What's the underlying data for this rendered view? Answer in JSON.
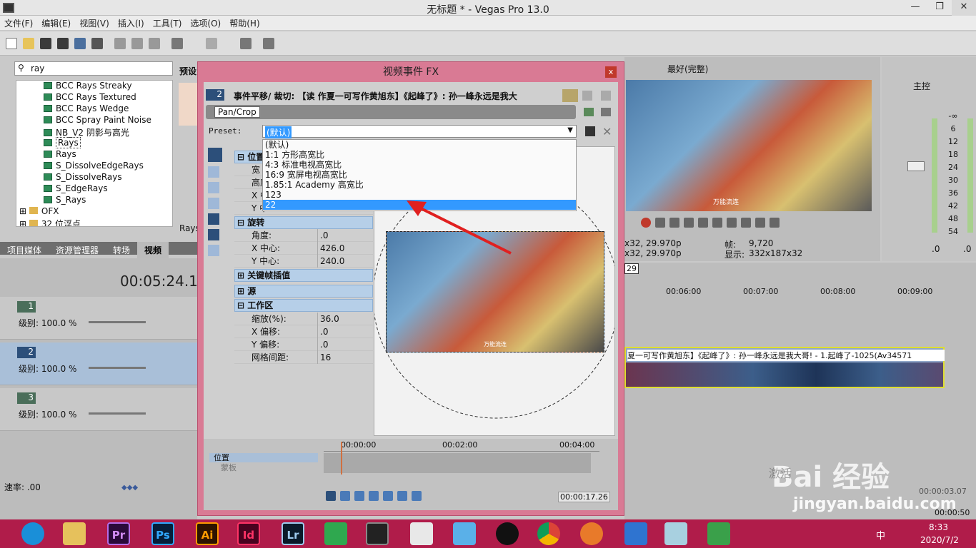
{
  "window": {
    "title": "无标题 * - Vegas Pro 13.0",
    "minimize": "—",
    "restore": "❐",
    "close": "✕"
  },
  "menu": [
    "文件(F)",
    "编辑(E)",
    "视图(V)",
    "插入(I)",
    "工具(T)",
    "选项(O)",
    "帮助(H)"
  ],
  "explorer": {
    "search_value": "ray",
    "preset_label": "预设",
    "items": [
      "BCC Rays Streaky",
      "BCC Rays Textured",
      "BCC Rays Wedge",
      "BCC Spray Paint Noise",
      "NB_V2 阴影与高光",
      "Rays",
      "Rays",
      "S_DissolveEdgeRays",
      "S_DissolveRays",
      "S_EdgeRays",
      "S_Rays"
    ],
    "folders": [
      "OFX",
      "32 位浮点"
    ],
    "selected_index": 5,
    "preview_caption": "Rays",
    "tabs": [
      "项目媒体",
      "资源管理器",
      "转场",
      "视频"
    ]
  },
  "timecode": "00:05:24.10",
  "tracks": [
    {
      "num": "1",
      "level": "级别: 100.0 %"
    },
    {
      "num": "2",
      "level": "级别: 100.0 %"
    },
    {
      "num": "3",
      "level": "级别: 100.0 %"
    }
  ],
  "rate_label": "速率: .00",
  "fx": {
    "title": "视频事件 FX",
    "close": "x",
    "chain_badge": "2",
    "chain_title": "事件平移/ 裁切: 【读 作夏一可写作黄旭东】《起峰了》: 孙一峰永远是我大",
    "plugin": "Pan/Crop",
    "preset_label": "Preset:",
    "preset_value": "(默认)",
    "preset_options": [
      "(默认)",
      "1:1 方形高宽比",
      "4:3 标准电视高宽比",
      "16:9 宽屏电视高宽比",
      "1.85:1 Academy 高宽比",
      "123",
      "22"
    ],
    "preset_selected": 6,
    "sections": {
      "position": "位置",
      "position_rows": [
        "宽",
        "高度",
        "X 中",
        "Y 中"
      ],
      "rotation": "旋转",
      "rotation_rows": [
        [
          "角度:",
          ".0"
        ],
        [
          "X 中心:",
          "426.0"
        ],
        [
          "Y 中心:",
          "240.0"
        ]
      ],
      "keyframe": "关键帧插值",
      "source": "源",
      "workspace": "工作区",
      "workspace_rows": [
        [
          "缩放(%):",
          "36.0"
        ],
        [
          "X 偏移:",
          ".0"
        ],
        [
          "Y 偏移:",
          ".0"
        ],
        [
          "网格间距:",
          "16"
        ]
      ]
    },
    "preview_caption": "万能流连",
    "keytrack": {
      "ruler": [
        "00:00:00",
        "00:02:00",
        "00:04:00"
      ],
      "row1": "位置",
      "row2": "蒙板"
    },
    "bottom_time": "00:00:17.26"
  },
  "preview": {
    "quality": "最好(完整)",
    "info": {
      "left1": "x32, 29.970p",
      "left2": "x32, 29.970p",
      "frame_label": "帧:",
      "frame": "9,720",
      "display_label": "显示:",
      "display": "332x187x32"
    },
    "caption": "万能流连"
  },
  "master": {
    "label": "主控",
    "scale": [
      "-∞",
      "6",
      "12",
      "18",
      "24",
      "30",
      "36",
      "42",
      "48",
      "54"
    ],
    "zero_left": ".0",
    "zero_right": ".0"
  },
  "timeline": {
    "marker": "29",
    "ticks": [
      "00:06:00",
      "00:07:00",
      "00:08:00",
      "00:09:00"
    ],
    "clip_title": "夏一可写作黄旭东】《起峰了》: 孙一峰永远是我大哥! - 1.起峰了-1025(Av34571",
    "time_end": "00:00:03.07",
    "time_bottom": "00:00:50"
  },
  "watermark": {
    "brand": "Bai 经验",
    "url": "jingyan.baidu.com",
    "activate": "激活"
  },
  "taskbar": {
    "apps": [
      "Pr",
      "Ps",
      "Ai",
      "Id",
      "Lr"
    ],
    "time": "8:33",
    "date": "2020/7/2",
    "ime": "中"
  }
}
